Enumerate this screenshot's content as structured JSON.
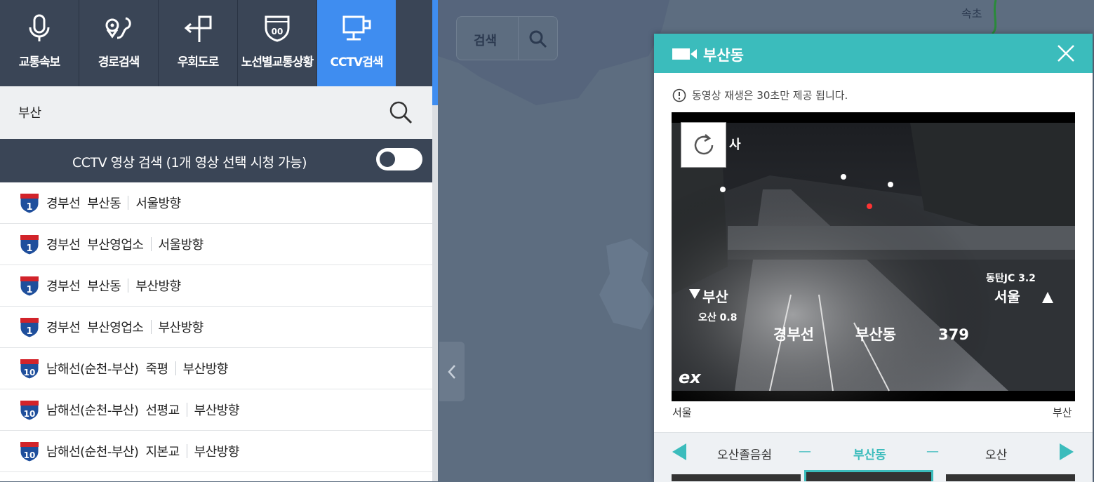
{
  "nav": {
    "tabs": [
      {
        "label": "교통속보",
        "icon": "microphone-icon"
      },
      {
        "label": "경로검색",
        "icon": "route-icon"
      },
      {
        "label": "우회도로",
        "icon": "detour-icon"
      },
      {
        "label": "노선별교통상황",
        "icon": "highway-icon"
      },
      {
        "label": "CCTV검색",
        "icon": "cctv-icon",
        "active": true
      }
    ],
    "active_color": "#3f8df0"
  },
  "search": {
    "value": "부산"
  },
  "cctv_bar": {
    "title": "CCTV 영상 검색 (1개 영상 선택 시청 가능)",
    "toggle_on": false
  },
  "results": [
    {
      "route_no": "1",
      "road": "경부선",
      "place": "부산동",
      "direction": "서울방향"
    },
    {
      "route_no": "1",
      "road": "경부선",
      "place": "부산영업소",
      "direction": "서울방향"
    },
    {
      "route_no": "1",
      "road": "경부선",
      "place": "부산동",
      "direction": "부산방향"
    },
    {
      "route_no": "1",
      "road": "경부선",
      "place": "부산영업소",
      "direction": "부산방향"
    },
    {
      "route_no": "10",
      "road": "남해선(순천-부산)",
      "place": "죽평",
      "direction": "부산방향"
    },
    {
      "route_no": "10",
      "road": "남해선(순천-부산)",
      "place": "선평교",
      "direction": "부산방향"
    },
    {
      "route_no": "10",
      "road": "남해선(순천-부산)",
      "place": "지본교",
      "direction": "부산방향"
    }
  ],
  "map": {
    "search_label": "검색",
    "city_label": "속초"
  },
  "popup": {
    "title": "부산동",
    "notice": "동영상 재생은 30초만 제공 됩니다.",
    "direction_left": "서울",
    "direction_right": "부산",
    "header_color": "#3bbcbc",
    "video_overlay": {
      "sign_left": "부산",
      "sign_left_sub": "오산 0.8",
      "sign_right_top": "동탄JC 3.2",
      "sign_right": "서울",
      "road_name": "경부선",
      "place_name": "부산동",
      "number": "379",
      "logo": "ex",
      "corner_text": "사"
    },
    "nav": {
      "prev": "오산졸음쉼",
      "current": "부산동",
      "next": "오산"
    }
  }
}
